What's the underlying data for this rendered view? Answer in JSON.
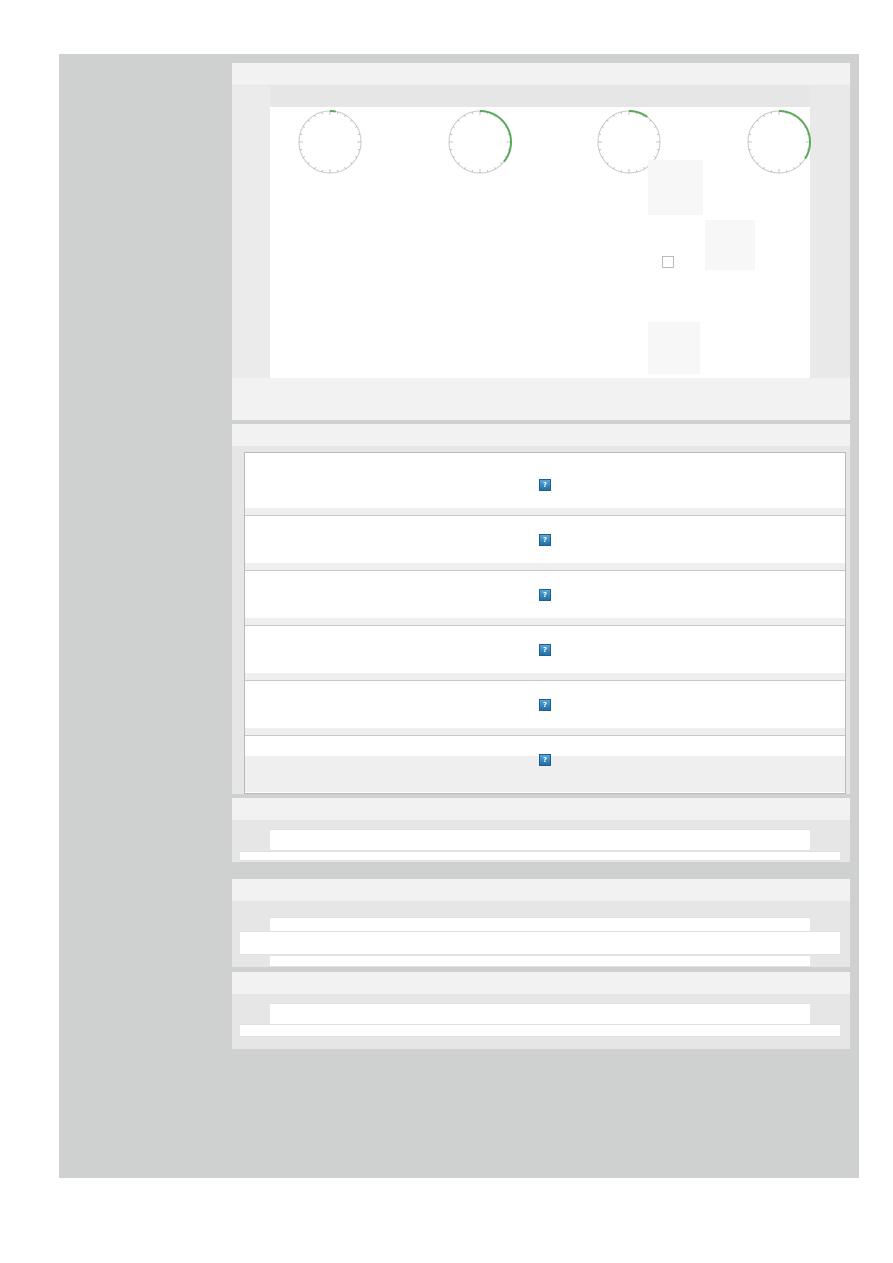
{
  "gauges": [
    {
      "id": "gauge-1",
      "fill": 0.03
    },
    {
      "id": "gauge-2",
      "fill": 0.36
    },
    {
      "id": "gauge-3",
      "fill": 0.1
    },
    {
      "id": "gauge-4",
      "fill": 0.34
    }
  ],
  "help_rows": [
    {
      "help_label": "?"
    },
    {
      "help_label": "?"
    },
    {
      "help_label": "?"
    },
    {
      "help_label": "?"
    },
    {
      "help_label": "?"
    },
    {
      "help_label": "?"
    }
  ],
  "colors": {
    "frame": "#cfd1d0",
    "gauge_fill": "#5aa85a",
    "gauge_ring": "#c9c9c9",
    "help_icon": "#2a80bb"
  }
}
